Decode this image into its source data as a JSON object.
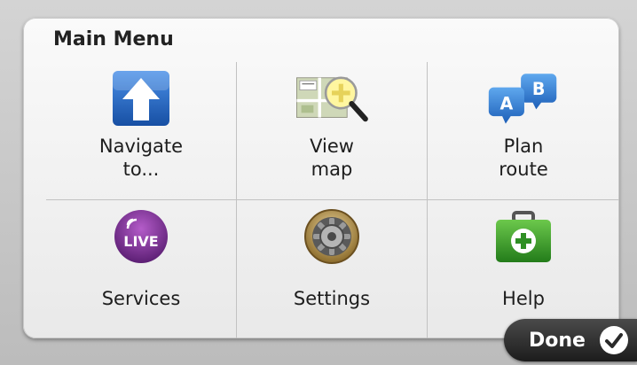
{
  "menu": {
    "title": "Main Menu",
    "items": [
      {
        "label": "Navigate\nto...",
        "icon": "navigate-arrow-icon"
      },
      {
        "label": "View\nmap",
        "icon": "map-magnifier-icon"
      },
      {
        "label": "Plan\nroute",
        "icon": "route-ab-icon"
      },
      {
        "label": "Services",
        "icon": "live-services-icon",
        "badge": "LIVE"
      },
      {
        "label": "Settings",
        "icon": "gear-icon"
      },
      {
        "label": "Help",
        "icon": "first-aid-kit-icon"
      }
    ]
  },
  "plan_route_badges": {
    "a": "A",
    "b": "B"
  },
  "done_button": {
    "label": "Done",
    "icon": "checkmark-icon"
  },
  "colors": {
    "navigate_blue": "#1f66c4",
    "route_blue": "#2f86d8",
    "live_purple": "#7a2f8f",
    "help_green": "#3a9e2a",
    "done_dark": "#2a2a2a"
  }
}
